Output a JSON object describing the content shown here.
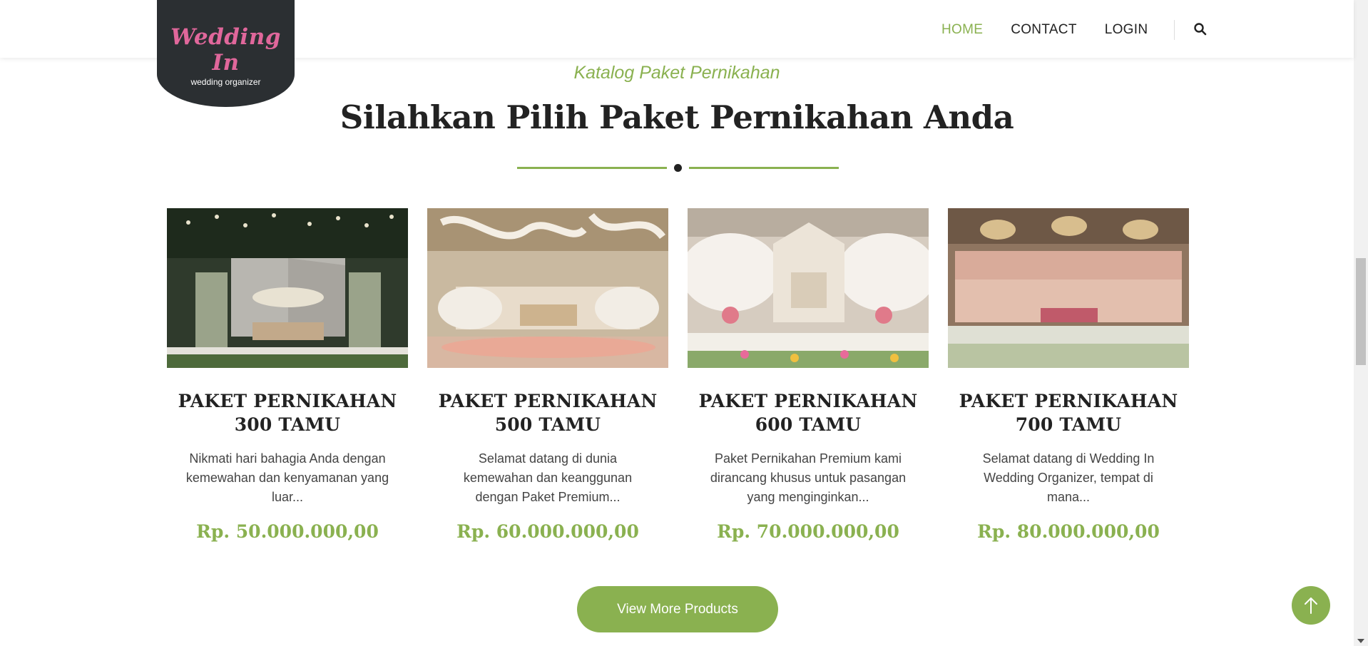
{
  "brand": {
    "name": "Wedding In",
    "tagline": "wedding organizer"
  },
  "nav": {
    "items": [
      {
        "label": "HOME",
        "active": true
      },
      {
        "label": "CONTACT",
        "active": false
      },
      {
        "label": "LOGIN",
        "active": false
      }
    ],
    "search_icon": "search-icon"
  },
  "section": {
    "subtitle": "Katalog Paket Pernikahan",
    "title": "Silahkan Pilih Paket Pernikahan Anda"
  },
  "products": [
    {
      "title_line1": "PAKET PERNIKAHAN",
      "title_line2": "300 TAMU",
      "description": "Nikmati hari bahagia Anda dengan kemewahan dan kenyamanan yang luar...",
      "price": "Rp. 50.000.000,00"
    },
    {
      "title_line1": "PAKET PERNIKAHAN",
      "title_line2": "500 TAMU",
      "description": "Selamat datang di dunia kemewahan dan keanggunan dengan Paket Premium...",
      "price": "Rp. 60.000.000,00"
    },
    {
      "title_line1": "PAKET PERNIKAHAN",
      "title_line2": "600 TAMU",
      "description": "Paket Pernikahan Premium kami dirancang khusus untuk pasangan yang menginginkan...",
      "price": "Rp. 70.000.000,00"
    },
    {
      "title_line1": "PAKET PERNIKAHAN",
      "title_line2": "700 TAMU",
      "description": "Selamat datang di Wedding In Wedding Organizer, tempat di mana...",
      "price": "Rp. 80.000.000,00"
    }
  ],
  "view_more_label": "View More Products",
  "colors": {
    "accent": "#8ab150",
    "logo_bg": "#2b2f32",
    "logo_text": "#e0679b",
    "text": "#222222"
  }
}
